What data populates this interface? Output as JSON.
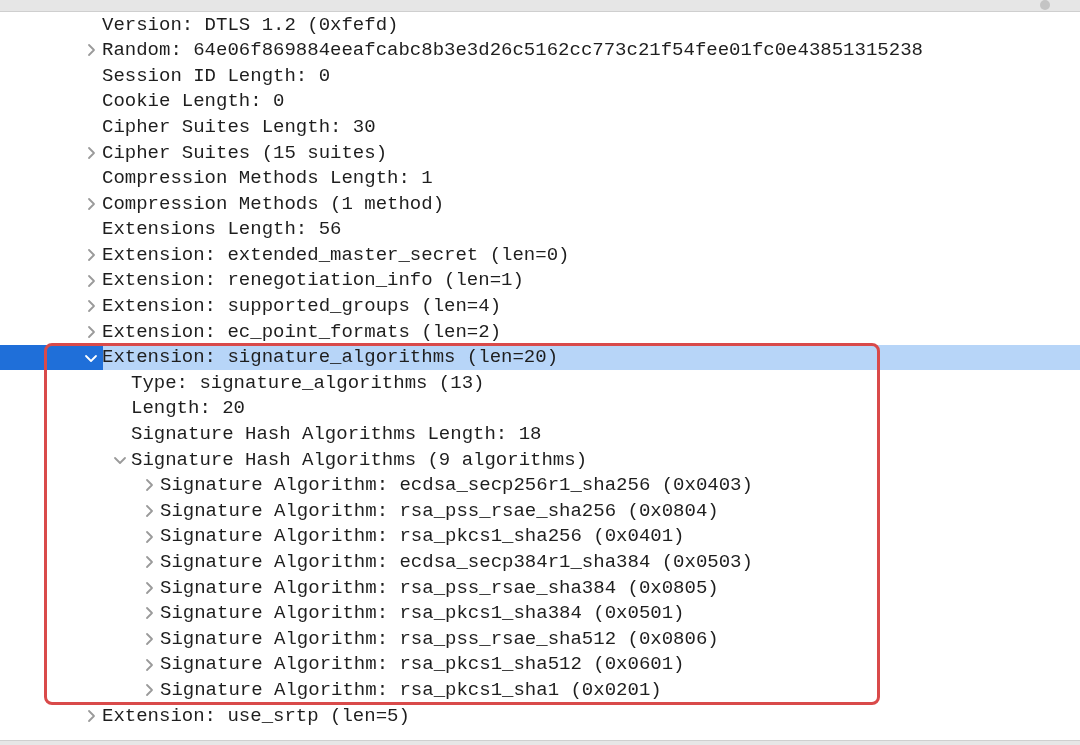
{
  "tree": [
    {
      "label": "Version: DTLS 1.2 (0xfefd)",
      "selected": false
    },
    {
      "label": "Random: 64e06f869884eeafcabc8b3e3d26c5162cc773c21f54fee01fc0e43851315238",
      "selected": false,
      "expanded": false
    },
    {
      "label": "Session ID Length: 0",
      "selected": false
    },
    {
      "label": "Cookie Length: 0",
      "selected": false
    },
    {
      "label": "Cipher Suites Length: 30",
      "selected": false
    },
    {
      "label": "Cipher Suites (15 suites)",
      "selected": false,
      "expanded": false
    },
    {
      "label": "Compression Methods Length: 1",
      "selected": false
    },
    {
      "label": "Compression Methods (1 method)",
      "selected": false,
      "expanded": false
    },
    {
      "label": "Extensions Length: 56",
      "selected": false
    },
    {
      "label": "Extension: extended_master_secret (len=0)",
      "selected": false,
      "expanded": false
    },
    {
      "label": "Extension: renegotiation_info (len=1)",
      "selected": false,
      "expanded": false
    },
    {
      "label": "Extension: supported_groups (len=4)",
      "selected": false,
      "expanded": false
    },
    {
      "label": "Extension: ec_point_formats (len=2)",
      "selected": false,
      "expanded": false
    },
    {
      "label": "Extension: signature_algorithms (len=20)",
      "selected": true,
      "expanded": true,
      "annotated": true,
      "children": [
        {
          "label": "Type: signature_algorithms (13)",
          "selected": false
        },
        {
          "label": "Length: 20",
          "selected": false
        },
        {
          "label": "Signature Hash Algorithms Length: 18",
          "selected": false
        },
        {
          "label": "Signature Hash Algorithms (9 algorithms)",
          "selected": false,
          "expanded": true,
          "children": [
            {
              "label": "Signature Algorithm: ecdsa_secp256r1_sha256 (0x0403)",
              "selected": false,
              "expanded": false
            },
            {
              "label": "Signature Algorithm: rsa_pss_rsae_sha256 (0x0804)",
              "selected": false,
              "expanded": false
            },
            {
              "label": "Signature Algorithm: rsa_pkcs1_sha256 (0x0401)",
              "selected": false,
              "expanded": false
            },
            {
              "label": "Signature Algorithm: ecdsa_secp384r1_sha384 (0x0503)",
              "selected": false,
              "expanded": false
            },
            {
              "label": "Signature Algorithm: rsa_pss_rsae_sha384 (0x0805)",
              "selected": false,
              "expanded": false
            },
            {
              "label": "Signature Algorithm: rsa_pkcs1_sha384 (0x0501)",
              "selected": false,
              "expanded": false
            },
            {
              "label": "Signature Algorithm: rsa_pss_rsae_sha512 (0x0806)",
              "selected": false,
              "expanded": false
            },
            {
              "label": "Signature Algorithm: rsa_pkcs1_sha512 (0x0601)",
              "selected": false,
              "expanded": false
            },
            {
              "label": "Signature Algorithm: rsa_pkcs1_sha1 (0x0201)",
              "selected": false,
              "expanded": false
            }
          ]
        }
      ]
    },
    {
      "label": "Extension: use_srtp (len=5)",
      "selected": false,
      "expanded": false
    }
  ]
}
